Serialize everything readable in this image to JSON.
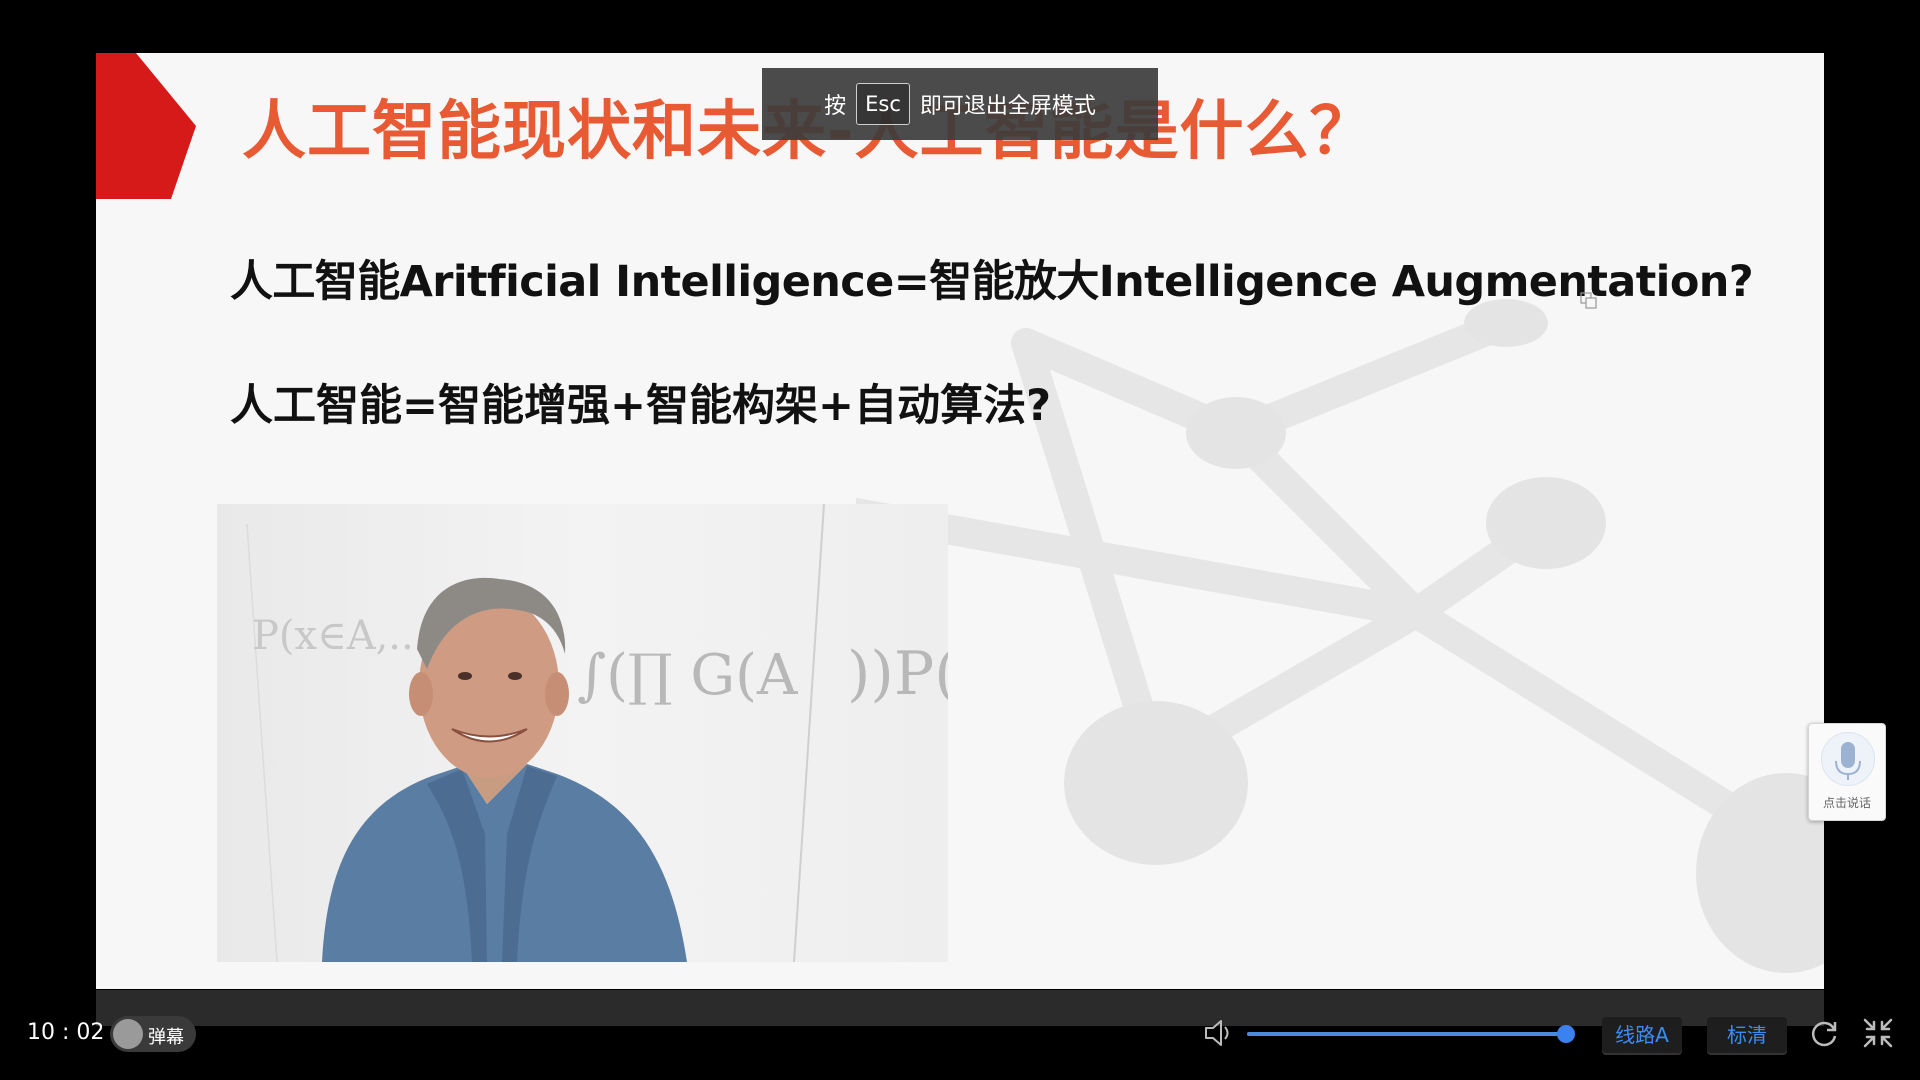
{
  "slide": {
    "title": "人工智能现状和未来-人工智能是什么？",
    "line1": "人工智能Aritficial Intelligence=智能放大Intelligence Augmentation?",
    "line2": "人工智能=智能增强+智能构架+自动算法?",
    "photo_formula_text": "P(x∈A,...,X ∫(∏ G(A_i)) P(",
    "accent_color": "#d61a1a",
    "title_color": "#e85a33"
  },
  "esc_toast": {
    "prefix": "按",
    "key": "Esc",
    "suffix": "即可退出全屏模式"
  },
  "mic_widget": {
    "label": "点击说话",
    "icon": "microphone-icon"
  },
  "controls": {
    "time": "10 : 02",
    "danmu_label": "弹幕",
    "volume_fraction": 0.98,
    "route_label": "线路A",
    "quality_label": "标清",
    "icons": [
      "volume-icon",
      "refresh-icon",
      "exit-fullscreen-icon",
      "copy-icon"
    ],
    "accent_color": "#3a8df5"
  }
}
